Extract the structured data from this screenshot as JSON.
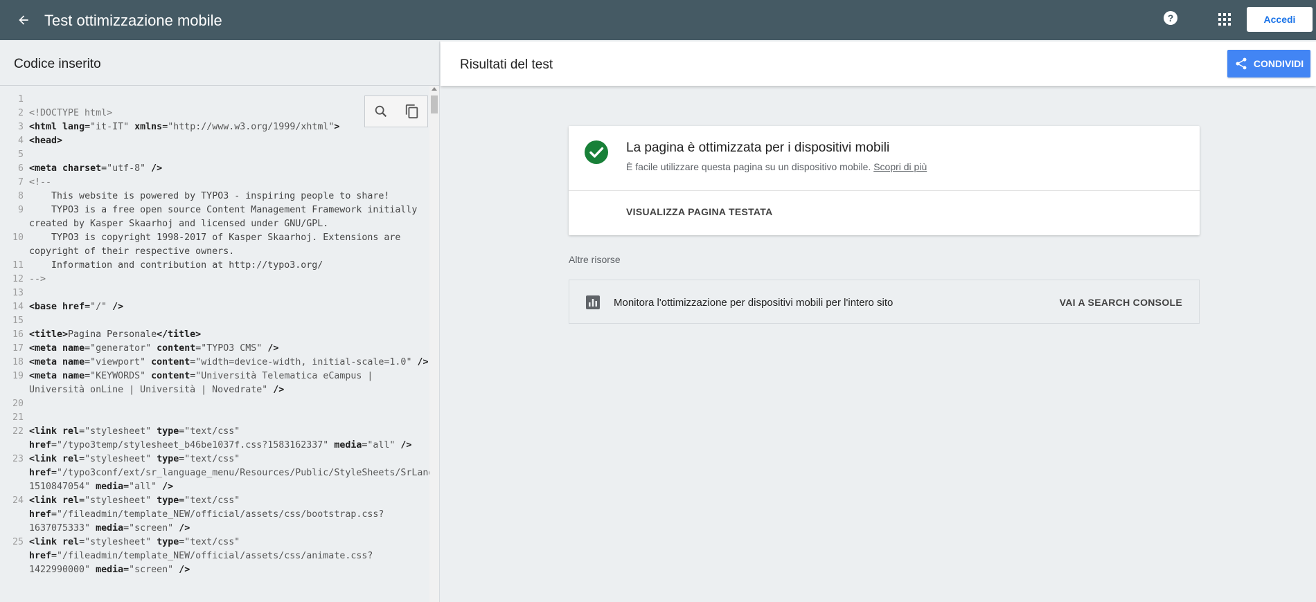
{
  "topbar": {
    "title": "Test ottimizzazione mobile",
    "login_label": "Accedi"
  },
  "left_panel": {
    "title": "Codice inserito"
  },
  "code": [
    {
      "n": "1",
      "html": ""
    },
    {
      "n": "2",
      "html": "<span class='cmt'>&lt;!DOCTYPE html&gt;</span>"
    },
    {
      "n": "3",
      "html": "<span class='tag'>&lt;html</span> <span class='attr'>lang</span>=<span class='val'>\"it-IT\"</span> <span class='attr'>xmlns</span>=<span class='val'>\"http://www.w3.org/1999/xhtml\"</span><span class='tag'>&gt;</span>"
    },
    {
      "n": "4",
      "html": "<span class='tag'>&lt;head&gt;</span>"
    },
    {
      "n": "5",
      "html": ""
    },
    {
      "n": "6",
      "html": "<span class='tag'>&lt;meta</span> <span class='attr'>charset</span>=<span class='val'>\"utf-8\"</span> <span class='tag'>/&gt;</span>"
    },
    {
      "n": "7",
      "html": "<span class='cmt'>&lt;!--</span>"
    },
    {
      "n": "8",
      "html": "<span class='txt'>    This website is powered by TYPO3 - inspiring people to share!</span>"
    },
    {
      "n": "9",
      "html": "<span class='txt'>    TYPO3 is a free open source Content Management Framework initially created by Kasper Skaarhoj and licensed under GNU/GPL.</span>"
    },
    {
      "n": "10",
      "html": "<span class='txt'>    TYPO3 is copyright 1998-2017 of Kasper Skaarhoj. Extensions are copyright of their respective owners.</span>"
    },
    {
      "n": "11",
      "html": "<span class='txt'>    Information and contribution at http://typo3.org/</span>"
    },
    {
      "n": "12",
      "html": "<span class='cmt'>--&gt;</span>"
    },
    {
      "n": "13",
      "html": ""
    },
    {
      "n": "14",
      "html": "<span class='tag'>&lt;base</span> <span class='attr'>href</span>=<span class='val'>\"/\"</span> <span class='tag'>/&gt;</span>"
    },
    {
      "n": "15",
      "html": ""
    },
    {
      "n": "16",
      "html": "<span class='tag'>&lt;title&gt;</span><span class='txt'>Pagina Personale</span><span class='tag'>&lt;/title&gt;</span>"
    },
    {
      "n": "17",
      "html": "<span class='tag'>&lt;meta</span> <span class='attr'>name</span>=<span class='val'>\"generator\"</span> <span class='attr'>content</span>=<span class='val'>\"TYPO3 CMS\"</span> <span class='tag'>/&gt;</span>"
    },
    {
      "n": "18",
      "html": "<span class='tag'>&lt;meta</span> <span class='attr'>name</span>=<span class='val'>\"viewport\"</span> <span class='attr'>content</span>=<span class='val'>\"width=device-width, initial-scale=1.0\"</span> <span class='tag'>/&gt;</span>"
    },
    {
      "n": "19",
      "html": "<span class='tag'>&lt;meta</span> <span class='attr'>name</span>=<span class='val'>\"KEYWORDS\"</span> <span class='attr'>content</span>=<span class='val'>\"Università Telematica eCampus | Università onLine | Università | Novedrate\"</span> <span class='tag'>/&gt;</span>"
    },
    {
      "n": "20",
      "html": ""
    },
    {
      "n": "21",
      "html": ""
    },
    {
      "n": "22",
      "html": "<span class='tag'>&lt;link</span> <span class='attr'>rel</span>=<span class='val'>\"stylesheet\"</span> <span class='attr'>type</span>=<span class='val'>\"text/css\"</span> <span class='attr'>href</span>=<span class='val'>\"/typo3temp/stylesheet_b46be1037f.css?1583162337\"</span> <span class='attr'>media</span>=<span class='val'>\"all\"</span> <span class='tag'>/&gt;</span>"
    },
    {
      "n": "23",
      "html": "<span class='tag'>&lt;link</span> <span class='attr'>rel</span>=<span class='val'>\"stylesheet\"</span> <span class='attr'>type</span>=<span class='val'>\"text/css\"</span> <span class='attr'>href</span>=<span class='val'>\"/typo3conf/ext/sr_language_menu/Resources/Public/StyleSheets/SrLanguageMenu.css?1510847054\"</span> <span class='attr'>media</span>=<span class='val'>\"all\"</span> <span class='tag'>/&gt;</span>"
    },
    {
      "n": "24",
      "html": "<span class='tag'>&lt;link</span> <span class='attr'>rel</span>=<span class='val'>\"stylesheet\"</span> <span class='attr'>type</span>=<span class='val'>\"text/css\"</span> <span class='attr'>href</span>=<span class='val'>\"/fileadmin/template_NEW/official/assets/css/bootstrap.css?1637075333\"</span> <span class='attr'>media</span>=<span class='val'>\"screen\"</span> <span class='tag'>/&gt;</span>"
    },
    {
      "n": "25",
      "html": "<span class='tag'>&lt;link</span> <span class='attr'>rel</span>=<span class='val'>\"stylesheet\"</span> <span class='attr'>type</span>=<span class='val'>\"text/css\"</span> <span class='attr'>href</span>=<span class='val'>\"/fileadmin/template_NEW/official/assets/css/animate.css?1422990000\"</span> <span class='attr'>media</span>=<span class='val'>\"screen\"</span> <span class='tag'>/&gt;</span>"
    }
  ],
  "right_panel": {
    "title": "Risultati del test",
    "share_label": "CONDIVIDI"
  },
  "result": {
    "title": "La pagina è ottimizzata per i dispositivi mobili",
    "description": "È facile utilizzare questa pagina su un dispositivo mobile.",
    "learn_more": "Scopri di più",
    "view_page": "VISUALIZZA PAGINA TESTATA",
    "status_color": "#188038"
  },
  "resources": {
    "label": "Altre risorse",
    "item_text": "Monitora l'ottimizzazione per dispositivi mobili per l'intero sito",
    "item_link": "VAI A SEARCH CONSOLE"
  },
  "icons": {
    "back": "arrow-back-icon",
    "help": "help-icon",
    "apps": "apps-grid-icon",
    "search": "search-icon",
    "copy": "copy-icon",
    "share": "share-icon",
    "check": "check-circle-icon",
    "chart": "bar-chart-icon"
  }
}
